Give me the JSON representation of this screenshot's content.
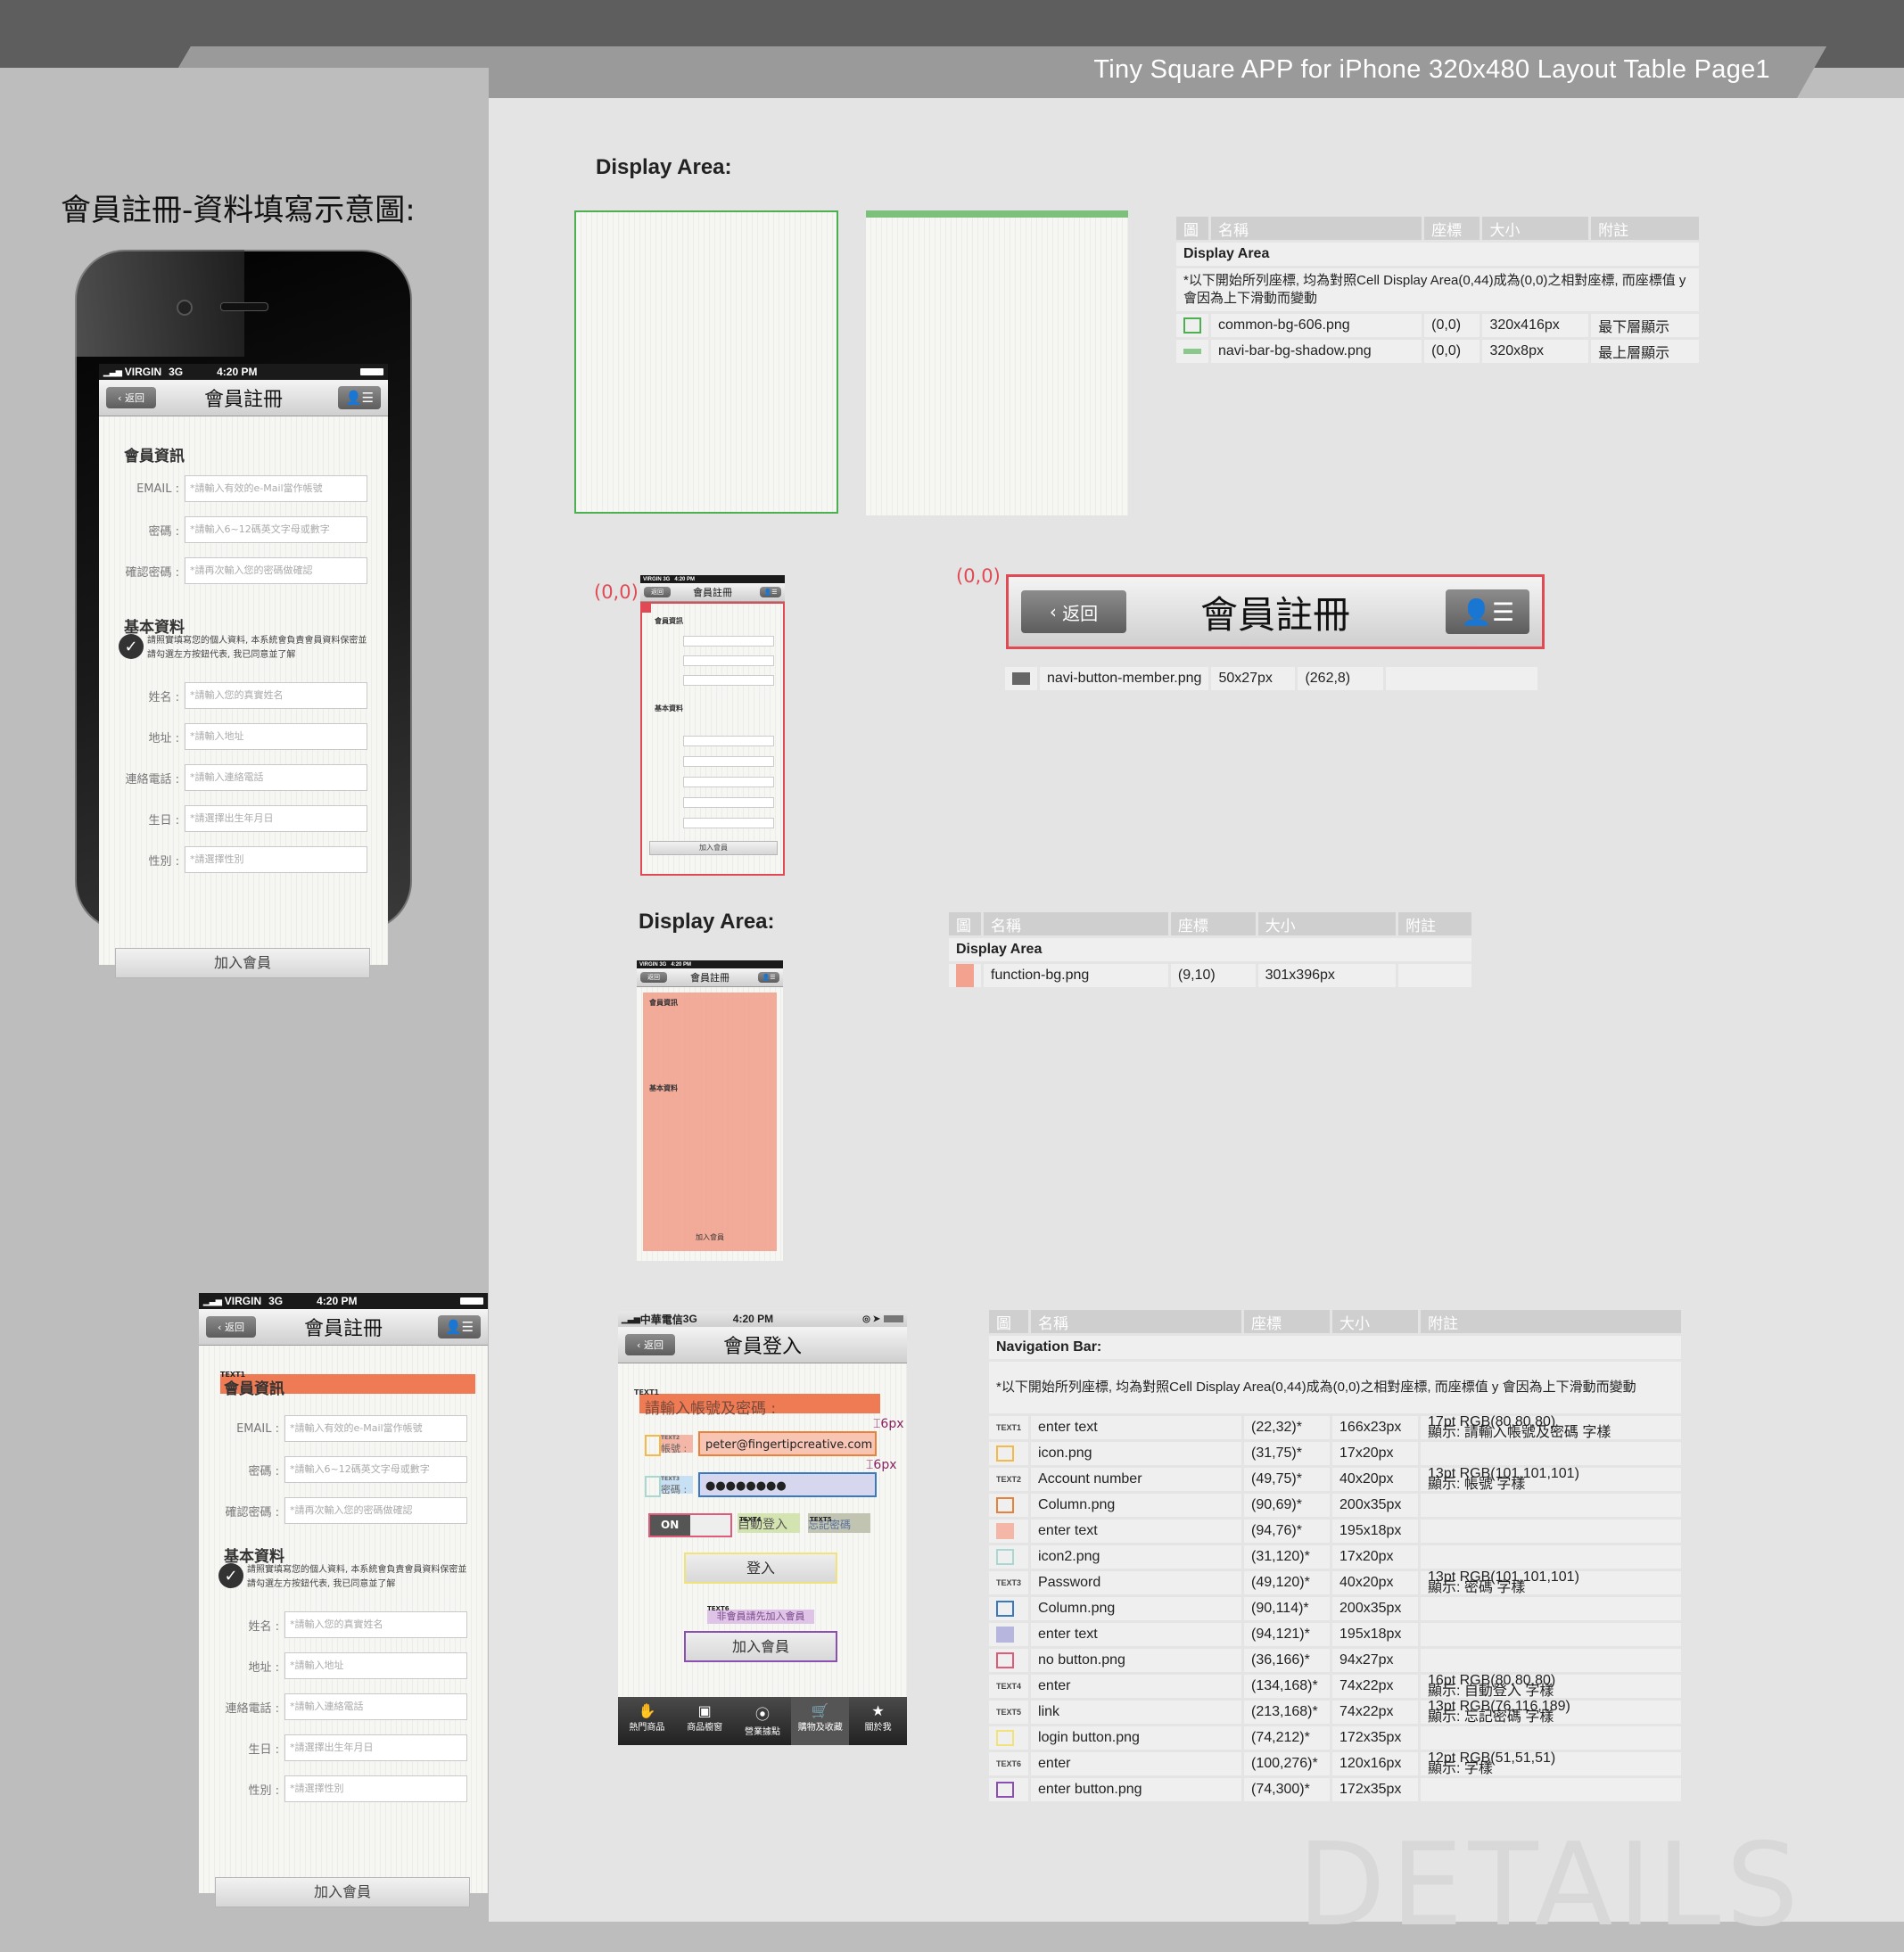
{
  "header": {
    "title": "Tiny Square APP for iPhone 320x480 Layout Table Page1"
  },
  "left": {
    "heading": "會員註冊-資料填寫示意圖:"
  },
  "statusbar": {
    "carrier": "VIRGIN",
    "network": "3G",
    "time": "4:20 PM"
  },
  "register_screen": {
    "back_label": "返回",
    "title": "會員註冊",
    "section_member": "會員資訊",
    "fields_member": [
      {
        "label": "EMAIL :",
        "placeholder": "*請輸入有效的e-Mail當作帳號"
      },
      {
        "label": "密碼 :",
        "placeholder": "*請輸入6~12碼英文字母或數字"
      },
      {
        "label": "確認密碼 :",
        "placeholder": "*請再次輸入您的密碼做確認"
      }
    ],
    "section_basic": "基本資料",
    "consent_text": "請照實填寫您的個人資料, 本系統會負責會員資料保密並請勾選左方按鈕代表, 我已同意並了解",
    "fields_basic": [
      {
        "label": "姓名 :",
        "placeholder": "*請輸入您的真實姓名"
      },
      {
        "label": "地址 :",
        "placeholder": "*請輸入地址"
      },
      {
        "label": "連絡電話 :",
        "placeholder": "*請輸入連絡電話"
      },
      {
        "label": "生日 :",
        "placeholder": "*請選擇出生年月日"
      },
      {
        "label": "性別 :",
        "placeholder": "*請選擇性別"
      }
    ],
    "join_button": "加入會員"
  },
  "display_area_1": {
    "label": "Display Area:",
    "table": {
      "headers": [
        "圖",
        "名稱",
        "座標",
        "大小",
        "附註"
      ],
      "subheader": "Display Area",
      "note": "*以下開始所列座標, 均為對照Cell Display Area(0,44)成為(0,0)之相對座標, 而座標值 y 會因為上下滑動而變動",
      "rows": [
        {
          "name": "common-bg-606.png",
          "coord": "(0,0)",
          "size": "320x416px",
          "note": "最下層顯示",
          "color": "#4caf50"
        },
        {
          "name": "navi-bar-bg-shadow.png",
          "coord": "(0,0)",
          "size": "320x8px",
          "note": "最上層顯示",
          "color": "#8bc88b"
        }
      ]
    }
  },
  "navi_detail": {
    "origin_label": "(0,0)",
    "back_label": "返回",
    "title": "會員註冊",
    "row": {
      "name": "navi-button-member.png",
      "size": "50x27px",
      "coord": "(262,8)",
      "note": ""
    }
  },
  "display_area_2": {
    "label": "Display Area:",
    "table": {
      "headers": [
        "圖",
        "名稱",
        "座標",
        "大小",
        "附註"
      ],
      "subheader": "Display Area",
      "rows": [
        {
          "name": "function-bg.png",
          "coord": "(9,10)",
          "size": "301x396px",
          "note": "",
          "color": "#f2a28f"
        }
      ]
    }
  },
  "text1_label": "TEXT1",
  "login_screen": {
    "carrier": "中華電信",
    "network": "3G",
    "time": "4:20 PM",
    "back_label": "返回",
    "title": "會員登入",
    "heading": "請輸入帳號及密碼 :",
    "account_label": "帳號 :",
    "account_value": "peter@fingertipcreative.com",
    "password_label": "密碼 :",
    "password_value": "●●●●●●●●",
    "toggle_label": "ON",
    "auto_login": "自動登入",
    "forgot": "忘記密碼",
    "login_button": "登入",
    "nonmember": "非會員請先加入會員",
    "join_button": "加入會員",
    "tabs": [
      "熱門商品",
      "商品櫥窗",
      "營業據點",
      "購物及收藏",
      "關於我"
    ],
    "spacing_1": "6px",
    "spacing_2": "6px",
    "text_tags": [
      "TEXT1",
      "TEXT2",
      "TEXT3",
      "TEXT4",
      "TEXT5",
      "TEXT6"
    ]
  },
  "nav_table": {
    "headers": [
      "圖",
      "名稱",
      "座標",
      "大小",
      "附註"
    ],
    "subheader": "Navigation Bar:",
    "note": "*以下開始所列座標, 均為對照Cell Display Area(0,44)成為(0,0)之相對座標, 而座標值 y 會因為上下滑動而變動",
    "rows": [
      {
        "tag": "TEXT1",
        "name": "enter text",
        "coord": "(22,32)*",
        "size": "166x23px",
        "note1": "17pt RGB(80,80,80)",
        "note2": "顯示: 請輸入帳號及密碼 字樣",
        "color": "#e8664a"
      },
      {
        "tag": "",
        "name": "icon.png",
        "coord": "(31,75)*",
        "size": "17x20px",
        "note1": "",
        "note2": "",
        "color": "#f5b94a"
      },
      {
        "tag": "TEXT2",
        "name": "Account number",
        "coord": "(49,75)*",
        "size": "40x20px",
        "note1": "13pt RGB(101,101,101)",
        "note2": "顯示: 帳號 字樣",
        "color": ""
      },
      {
        "tag": "",
        "name": "Column.png",
        "coord": "(90,69)*",
        "size": "200x35px",
        "note1": "",
        "note2": "",
        "color": "#e8813a"
      },
      {
        "tag": "",
        "name": "enter text",
        "coord": "(94,76)*",
        "size": "195x18px",
        "note1": "",
        "note2": "",
        "color": "#f4b6a6"
      },
      {
        "tag": "",
        "name": "icon2.png",
        "coord": "(31,120)*",
        "size": "17x20px",
        "note1": "",
        "note2": "",
        "color": "#a8d8d0"
      },
      {
        "tag": "TEXT3",
        "name": "Password",
        "coord": "(49,120)*",
        "size": "40x20px",
        "note1": "13pt RGB(101,101,101)",
        "note2": "顯示: 密碼 字樣",
        "color": ""
      },
      {
        "tag": "",
        "name": "Column.png",
        "coord": "(90,114)*",
        "size": "200x35px",
        "note1": "",
        "note2": "",
        "color": "#3a78c0"
      },
      {
        "tag": "",
        "name": "enter text",
        "coord": "(94,121)*",
        "size": "195x18px",
        "note1": "",
        "note2": "",
        "color": "#b6b6de"
      },
      {
        "tag": "",
        "name": "no button.png",
        "coord": "(36,166)*",
        "size": "94x27px",
        "note1": "",
        "note2": "",
        "color": "#e05a7a"
      },
      {
        "tag": "TEXT4",
        "name": "enter",
        "coord": "(134,168)*",
        "size": "74x22px",
        "note1": "16pt RGB(80,80,80)",
        "note2": "顯示: 自動登入 字樣",
        "color": ""
      },
      {
        "tag": "TEXT5",
        "name": "link",
        "coord": "(213,168)*",
        "size": "74x22px",
        "note1": "13pt RGB(76,116,189)",
        "note2": "顯示: 忘記密碼 字樣",
        "color": ""
      },
      {
        "tag": "",
        "name": "login button.png",
        "coord": "(74,212)*",
        "size": "172x35px",
        "note1": "",
        "note2": "",
        "color": "#f2e27a"
      },
      {
        "tag": "TEXT6",
        "name": "enter",
        "coord": "(100,276)*",
        "size": "120x16px",
        "note1": "12pt RGB(51,51,51)",
        "note2": "顯示: 字樣",
        "color": ""
      },
      {
        "tag": "",
        "name": "enter button.png",
        "coord": "(74,300)*",
        "size": "172x35px",
        "note1": "",
        "note2": "",
        "color": "#8a4fb0"
      }
    ]
  },
  "watermark": "DETAILS"
}
